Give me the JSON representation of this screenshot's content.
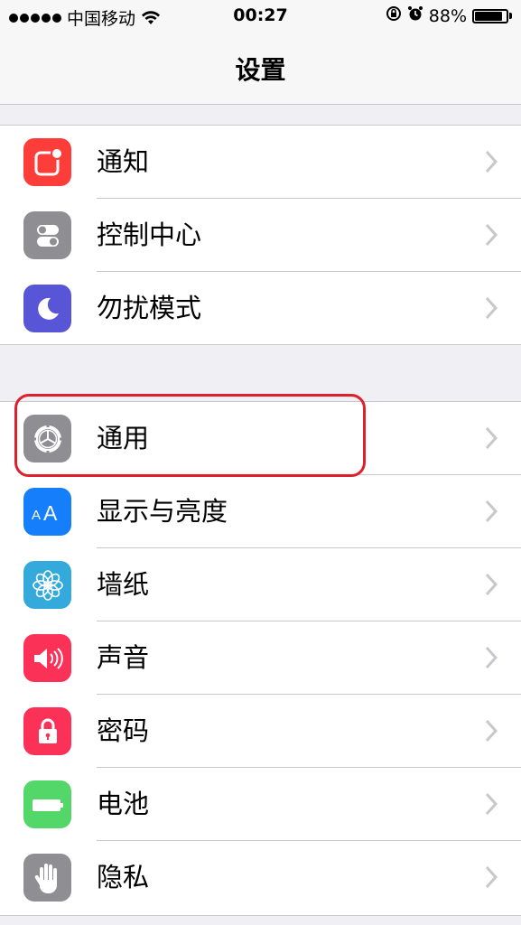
{
  "status_bar": {
    "carrier": "中国移动",
    "time": "00:27",
    "battery_percent": "88%",
    "battery_level": 0.88
  },
  "nav": {
    "title": "设置"
  },
  "groups": [
    {
      "items": [
        {
          "label": "通知",
          "icon": "notifications-icon",
          "color": "#fc3d39"
        },
        {
          "label": "控制中心",
          "icon": "control-center-icon",
          "color": "#8e8e93"
        },
        {
          "label": "勿扰模式",
          "icon": "moon-icon",
          "color": "#5856d6"
        }
      ]
    },
    {
      "items": [
        {
          "label": "通用",
          "icon": "gear-icon",
          "color": "#8e8e93"
        },
        {
          "label": "显示与亮度",
          "icon": "display-brightness-icon",
          "color": "#147efb"
        },
        {
          "label": "墙纸",
          "icon": "wallpaper-icon",
          "color": "#34aadc"
        },
        {
          "label": "声音",
          "icon": "speaker-icon",
          "color": "#fc3158"
        },
        {
          "label": "密码",
          "icon": "lock-icon",
          "color": "#fc3158"
        },
        {
          "label": "电池",
          "icon": "battery-icon",
          "color": "#53d769"
        },
        {
          "label": "隐私",
          "icon": "hand-icon",
          "color": "#8e8e93"
        }
      ]
    }
  ],
  "colors": {
    "highlight": "#e01f2d",
    "background": "#efeff4"
  }
}
